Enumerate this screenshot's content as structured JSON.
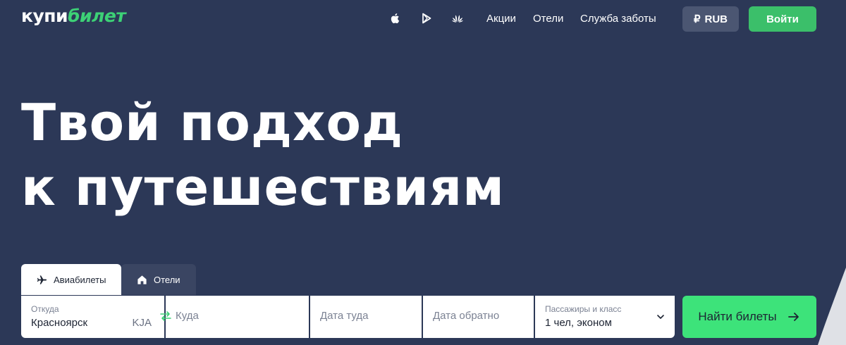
{
  "header": {
    "logo": {
      "part1": "купи",
      "part2": "билет"
    },
    "app_stores": [
      {
        "icon": "apple-icon"
      },
      {
        "icon": "google-play-icon"
      },
      {
        "icon": "huawei-icon"
      }
    ],
    "nav": [
      "Акции",
      "Отели",
      "Служба заботы"
    ],
    "currency": {
      "symbol": "₽",
      "code": "RUB"
    },
    "login_label": "Войти"
  },
  "hero": {
    "line1": "Твой подход",
    "line2": "к путешествиям"
  },
  "tabs": [
    {
      "label": "Авиабилеты",
      "icon": "airplane-icon",
      "active": true
    },
    {
      "label": "Отели",
      "icon": "home-icon",
      "active": false
    }
  ],
  "search": {
    "from": {
      "label": "Откуда",
      "value": "Красноярск",
      "code": "KJA"
    },
    "swap_icon": "swap-arrows-icon",
    "to": {
      "placeholder": "Куда"
    },
    "depart": {
      "placeholder": "Дата туда"
    },
    "return": {
      "placeholder": "Дата обратно"
    },
    "passengers": {
      "label": "Пассажиры и класс",
      "value": "1 чел, эконом"
    },
    "button_label": "Найти билеты"
  },
  "colors": {
    "background": "#2c3857",
    "accent_green": "#3bbf6a",
    "search_button": "#3de37a",
    "currency_button": "#4b5672",
    "inactive_tab": "#3a4562"
  }
}
